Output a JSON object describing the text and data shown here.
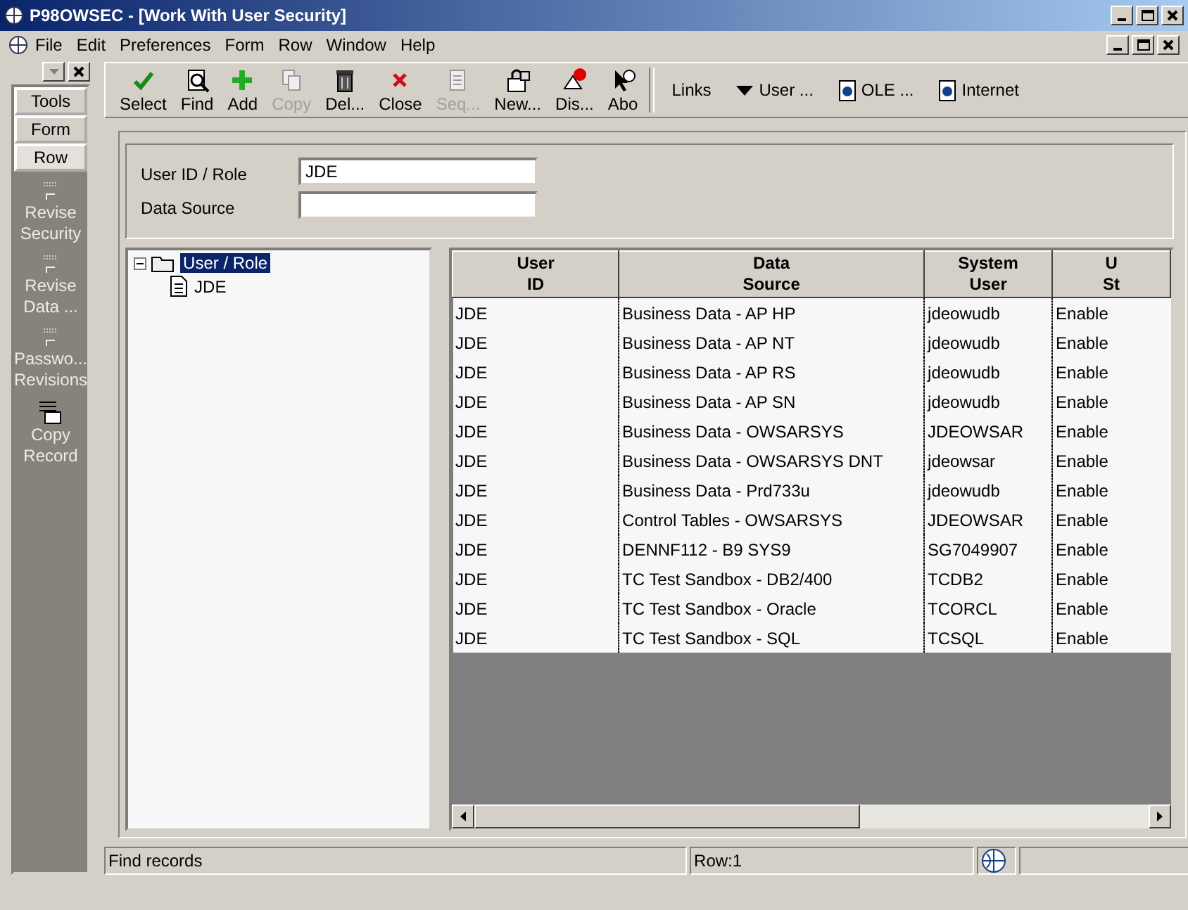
{
  "window": {
    "title": "P98OWSEC - [Work With User Security]"
  },
  "menu": [
    "File",
    "Edit",
    "Preferences",
    "Form",
    "Row",
    "Window",
    "Help"
  ],
  "toolbar": [
    {
      "label": "Select",
      "disabled": false
    },
    {
      "label": "Find",
      "disabled": false
    },
    {
      "label": "Add",
      "disabled": false
    },
    {
      "label": "Copy",
      "disabled": true
    },
    {
      "label": "Del...",
      "disabled": false
    },
    {
      "label": "Close",
      "disabled": false
    },
    {
      "label": "Seq...",
      "disabled": true
    },
    {
      "label": "New...",
      "disabled": false
    },
    {
      "label": "Dis...",
      "disabled": false
    },
    {
      "label": "Abo",
      "disabled": false
    }
  ],
  "links": [
    {
      "label": "Links",
      "kind": "label"
    },
    {
      "label": "User ...",
      "kind": "dropdown"
    },
    {
      "label": "OLE ...",
      "kind": "doc"
    },
    {
      "label": "Internet",
      "kind": "doc"
    }
  ],
  "side_panel": {
    "tabs": [
      {
        "label": "Tools",
        "selected": false
      },
      {
        "label": "Form",
        "selected": false
      },
      {
        "label": "Row",
        "selected": true
      }
    ],
    "exits": [
      {
        "lines": [
          "Revise",
          "Security"
        ]
      },
      {
        "lines": [
          "Revise",
          "Data ..."
        ]
      },
      {
        "lines": [
          "Passwo...",
          "Revisions"
        ]
      },
      {
        "lines": [
          "Copy",
          "Record"
        ]
      }
    ]
  },
  "header_fields": [
    {
      "label": "User ID / Role",
      "value": "JDE"
    },
    {
      "label": "Data Source"
    }
  ],
  "tree": {
    "label": "User / Role",
    "expanded": true,
    "selected": true,
    "children": [
      {
        "label": "JDE",
        "selected": false
      }
    ]
  },
  "table": {
    "columns": [
      {
        "lines": [
          "User",
          "ID"
        ]
      },
      {
        "lines": [
          "Data",
          "Source"
        ]
      },
      {
        "lines": [
          "System",
          "User"
        ]
      },
      {
        "lines": [
          "U",
          "St"
        ]
      }
    ],
    "rows": [
      [
        "JDE",
        "Business Data - AP HP",
        "jdeowudb",
        "Enable"
      ],
      [
        "JDE",
        "Business Data - AP NT",
        "jdeowudb",
        "Enable"
      ],
      [
        "JDE",
        "Business Data - AP RS",
        "jdeowudb",
        "Enable"
      ],
      [
        "JDE",
        "Business Data - AP SN",
        "jdeowudb",
        "Enable"
      ],
      [
        "JDE",
        "Business Data - OWSARSYS",
        "JDEOWSAR",
        "Enable"
      ],
      [
        "JDE",
        "Business Data - OWSARSYS DNT",
        "jdeowsar",
        "Enable"
      ],
      [
        "JDE",
        "Business Data - Prd733u",
        "jdeowudb",
        "Enable"
      ],
      [
        "JDE",
        "Control Tables - OWSARSYS",
        "JDEOWSAR",
        "Enable"
      ],
      [
        "JDE",
        "DENNF112 - B9 SYS9",
        "SG7049907",
        "Enable"
      ],
      [
        "JDE",
        "TC Test Sandbox - DB2/400",
        "TCDB2",
        "Enable"
      ],
      [
        "JDE",
        "TC Test Sandbox - Oracle",
        "TCORCL",
        "Enable"
      ],
      [
        "JDE",
        "TC Test Sandbox - SQL",
        "TCSQL",
        "Enable"
      ]
    ]
  },
  "status_bar": {
    "message": "Find records",
    "row": "Row:1"
  }
}
